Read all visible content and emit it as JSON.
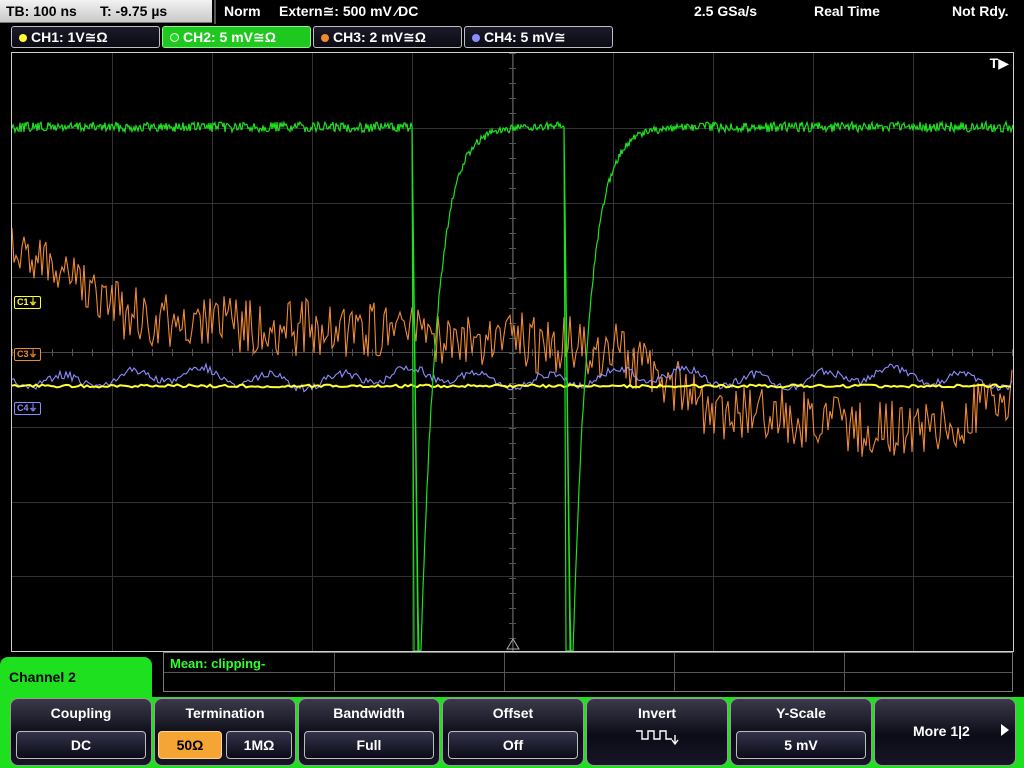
{
  "status_bar": {
    "timebase": "TB: 100 ns",
    "trigger_time": "T: -9.75 µs",
    "trigger_mode": "Norm",
    "trigger_source": "Extern≅: 500 mV ⁄DC",
    "sample_rate": "2.5 GSa/s",
    "acq_mode": "Real Time",
    "status": "Not Rdy."
  },
  "channels": [
    {
      "label": "CH1: 1V≅Ω",
      "color": "#ffff33",
      "active": false
    },
    {
      "label": "CH2: 5 mV≅Ω",
      "color": "#1ee01e",
      "active": true
    },
    {
      "label": "CH3: 2 mV≅Ω",
      "color": "#f08a30",
      "active": false
    },
    {
      "label": "CH4: 5 mV≅",
      "color": "#8c8cff",
      "active": false
    }
  ],
  "display": {
    "trigger_marker": "T▶",
    "markers": {
      "c1": "C1⏚",
      "c3": "C3⏚",
      "c4": "C4⏚"
    }
  },
  "measurement": {
    "label": "Mean: clipping-"
  },
  "menu": {
    "title": "Channel 2",
    "coupling": {
      "title": "Coupling",
      "value": "DC"
    },
    "termination": {
      "title": "Termination",
      "option_50": "50Ω",
      "option_1m": "1MΩ",
      "selected": "50Ω"
    },
    "bandwidth": {
      "title": "Bandwidth",
      "value": "Full"
    },
    "offset": {
      "title": "Offset",
      "value": "Off"
    },
    "invert": {
      "title": "Invert"
    },
    "yscale": {
      "title": "Y-Scale",
      "value": "5 mV"
    },
    "more": {
      "label": "More 1|2"
    }
  }
}
